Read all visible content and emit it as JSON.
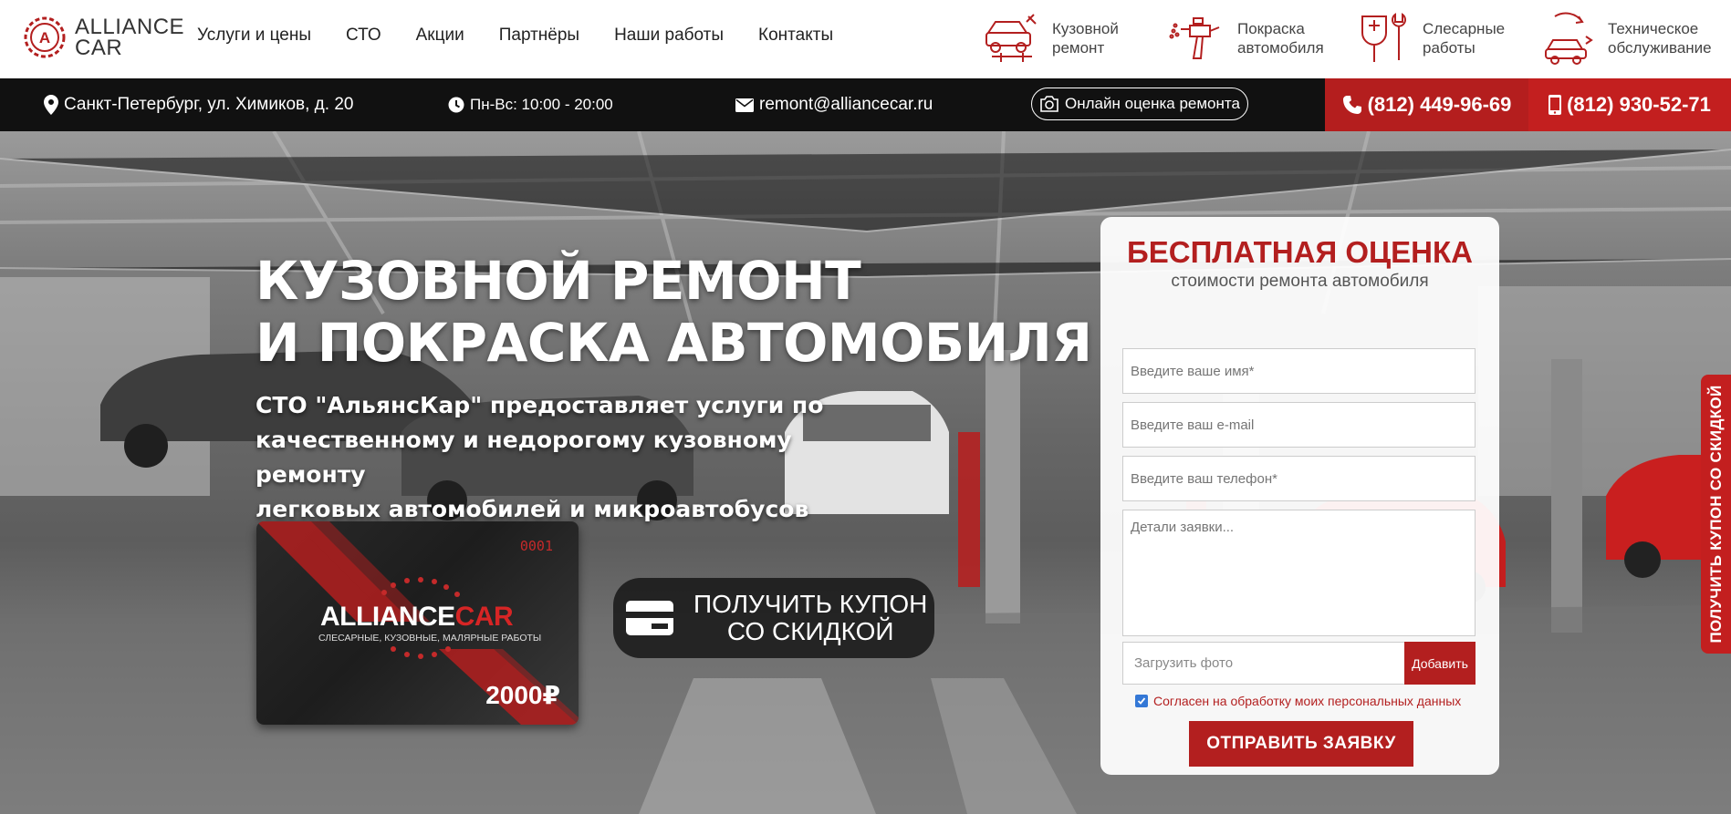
{
  "logo": {
    "line1": "ALLIANCE",
    "line2": "CAR"
  },
  "menu": [
    {
      "label": "Услуги и цены"
    },
    {
      "label": "СТО"
    },
    {
      "label": "Акции"
    },
    {
      "label": "Партнёры"
    },
    {
      "label": "Наши работы"
    },
    {
      "label": "Контакты"
    }
  ],
  "services": [
    {
      "line1": "Кузовной",
      "line2": "ремонт",
      "icon": "car-body-repair-icon"
    },
    {
      "line1": "Покраска",
      "line2": "автомобиля",
      "icon": "spray-gun-icon"
    },
    {
      "line1": "Слесарные",
      "line2": "работы",
      "icon": "wrench-icon"
    },
    {
      "line1": "Техническое",
      "line2": "обслуживание",
      "icon": "car-service-icon"
    }
  ],
  "infobar": {
    "address": "Санкт-Петербург, ул. Химиков, д. 20",
    "hours": "Пн-Вс: 10:00 - 20:00",
    "email": "remont@alliancecar.ru",
    "online": "Онлайн оценка ремонта",
    "phone1": "(812) 449-96-69",
    "phone2": "(812) 930-52-71"
  },
  "hero": {
    "title_line1": "КУЗОВНОЙ РЕМОНТ",
    "title_line2": "И ПОКРАСКА АВТОМОБИЛЯ",
    "subtitle_line1": "СТО \"АльянсКар\" предоставляет услуги по",
    "subtitle_line2": "качественному и недорогому кузовному ремонту",
    "subtitle_line3": "легковых автомобилей и микроавтобусов"
  },
  "card": {
    "number": "0001",
    "brand_white": "ALLIANCE",
    "brand_red": "CAR",
    "tagline": "СЛЕСАРНЫЕ, КУЗОВНЫЕ, МАЛЯРНЫЕ РАБОТЫ",
    "amount": "2000₽"
  },
  "coupon": {
    "line1": "ПОЛУЧИТЬ КУПОН",
    "line2": "СО СКИДКОЙ"
  },
  "form": {
    "title": "БЕСПЛАТНАЯ ОЦЕНКА",
    "subtitle": "стоимости ремонта автомобиля",
    "name_placeholder": "Введите ваше имя*",
    "email_placeholder": "Введите ваш e-mail",
    "phone_placeholder": "Введите ваш телефон*",
    "details_placeholder": "Детали заявки...",
    "upload_label": "Загрузить фото",
    "upload_button": "Добавить",
    "agree_label": "Согласен на обработку моих персональных данных",
    "agree_checked": true,
    "submit": "ОТПРАВИТЬ ЗАЯВКУ"
  },
  "side_tab": "ПОЛУЧИТЬ КУПОН СО СКИДКОЙ",
  "colors": {
    "accent": "#b31f1f",
    "dark": "#111111"
  }
}
